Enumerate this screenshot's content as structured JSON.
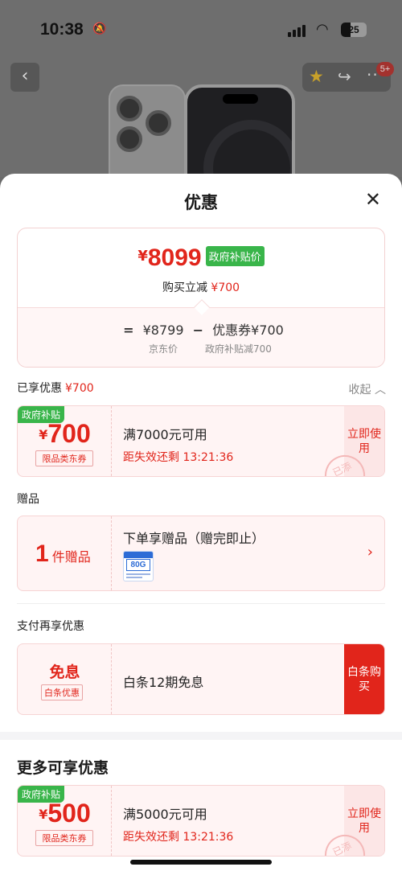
{
  "status_bar": {
    "time": "10:38",
    "battery": "25"
  },
  "header": {
    "badge": "5+"
  },
  "sheet": {
    "title": "优惠",
    "close": "✕"
  },
  "price_card": {
    "currency": "¥",
    "final_price": "8099",
    "gov_tag": "政府补贴价",
    "reduce_text": "购买立减",
    "reduce_amount": "¥700",
    "equals": "=",
    "jd_price": "¥8799",
    "minus": "−",
    "coupon_text": "优惠券¥700",
    "jd_price_label": "京东价",
    "coupon_label": "政府补贴减700"
  },
  "enjoyed": {
    "label": "已享优惠",
    "amount": "¥700",
    "collapse": "收起 ︿"
  },
  "coupon1": {
    "tag": "政府补贴",
    "currency": "¥",
    "amount": "700",
    "limit": "限品类东券",
    "desc": "满7000元可用",
    "expire": "距失效还剩 13:21:36",
    "use": "立即使用",
    "stamp": "已添"
  },
  "gifts": {
    "label": "赠品",
    "count": "1",
    "unit": "件赠品",
    "title": "下单享赠品（赠完即止）",
    "image_text": "80G",
    "arrow": "›"
  },
  "pay": {
    "label": "支付再享优惠",
    "title": "免息",
    "tag": "白条优惠",
    "desc": "白条12期免息",
    "buy": "白条购买"
  },
  "more": {
    "title": "更多可享优惠",
    "coupon": {
      "tag": "政府补贴",
      "currency": "¥",
      "amount": "500",
      "limit": "限品类东券",
      "desc": "满5000元可用",
      "expire": "距失效还剩 13:21:36",
      "use": "立即使用",
      "stamp": "已添"
    }
  },
  "colors": {
    "accent": "#e1251b",
    "gov_green": "#39b54a",
    "card_bg": "#fff4f4"
  },
  "icons": [
    "back-icon",
    "star-icon",
    "share-icon",
    "more-icon",
    "close-icon",
    "chevron-right-icon",
    "bell-off-icon",
    "wifi-icon",
    "signal-icon",
    "battery-icon"
  ]
}
